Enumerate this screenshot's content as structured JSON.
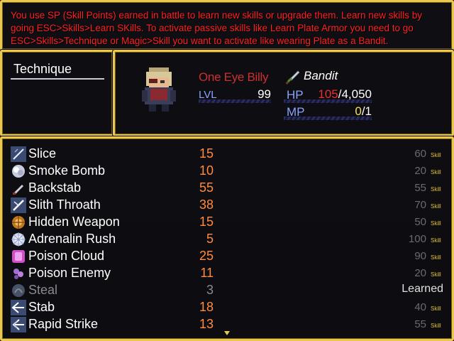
{
  "help_text": "You use SP (Skill Points) earned in battle to learn new skills or upgrade them. Learn new skills by going ESC>Skills>Learn SKills. To activate passive skills like Learn Plate Armor you need to go ESC>Skills>Technique or Magic>Skill you want to activate like wearing Plate as a Bandit.",
  "category": {
    "label": "Technique"
  },
  "actor": {
    "name": "One Eye Billy",
    "level_label": "LVL",
    "level": "99",
    "class_name": "Bandit",
    "class_icon": "dagger-icon",
    "hp_label": "HP",
    "hp_current": "105",
    "hp_max": "/4,050",
    "hp_ratio": 0.026,
    "mp_label": "MP",
    "mp_current": "0",
    "mp_max": "/1",
    "mp_ratio": 0.0
  },
  "skills": [
    {
      "name": "Slice",
      "icon": "slash-icon",
      "cost": "15",
      "price": "60",
      "unit": "Skill",
      "status": ""
    },
    {
      "name": "Smoke Bomb",
      "icon": "smoke-bomb-icon",
      "cost": "10",
      "price": "20",
      "unit": "Skill",
      "status": ""
    },
    {
      "name": "Backstab",
      "icon": "knife-icon",
      "cost": "55",
      "price": "55",
      "unit": "Skill",
      "status": ""
    },
    {
      "name": "Slith Throath",
      "icon": "throat-slash-icon",
      "cost": "38",
      "price": "70",
      "unit": "Skill",
      "status": ""
    },
    {
      "name": "Hidden Weapon",
      "icon": "hidden-weapon-icon",
      "cost": "15",
      "price": "50",
      "unit": "Skill",
      "status": ""
    },
    {
      "name": "Adrenalin Rush",
      "icon": "burst-icon",
      "cost": "5",
      "price": "100",
      "unit": "Skill",
      "status": ""
    },
    {
      "name": "Poison Cloud",
      "icon": "poison-cloud-icon",
      "cost": "25",
      "price": "90",
      "unit": "Skill",
      "status": ""
    },
    {
      "name": "Poison Enemy",
      "icon": "poison-drop-icon",
      "cost": "11",
      "price": "20",
      "unit": "Skill",
      "status": ""
    },
    {
      "name": "Steal",
      "icon": "steal-hand-icon",
      "cost": "3",
      "price": "",
      "unit": "",
      "status": "Learned"
    },
    {
      "name": "Stab",
      "icon": "stab-arrow-icon",
      "cost": "18",
      "price": "40",
      "unit": "Skill",
      "status": ""
    },
    {
      "name": "Rapid Strike",
      "icon": "rapid-arrow-icon",
      "cost": "13",
      "price": "55",
      "unit": "Skill",
      "status": ""
    }
  ],
  "colors": {
    "border": "#e8c850",
    "help_text": "#ff2020",
    "cost": "#ff8a40",
    "stat_label": "#8aa4ff"
  }
}
